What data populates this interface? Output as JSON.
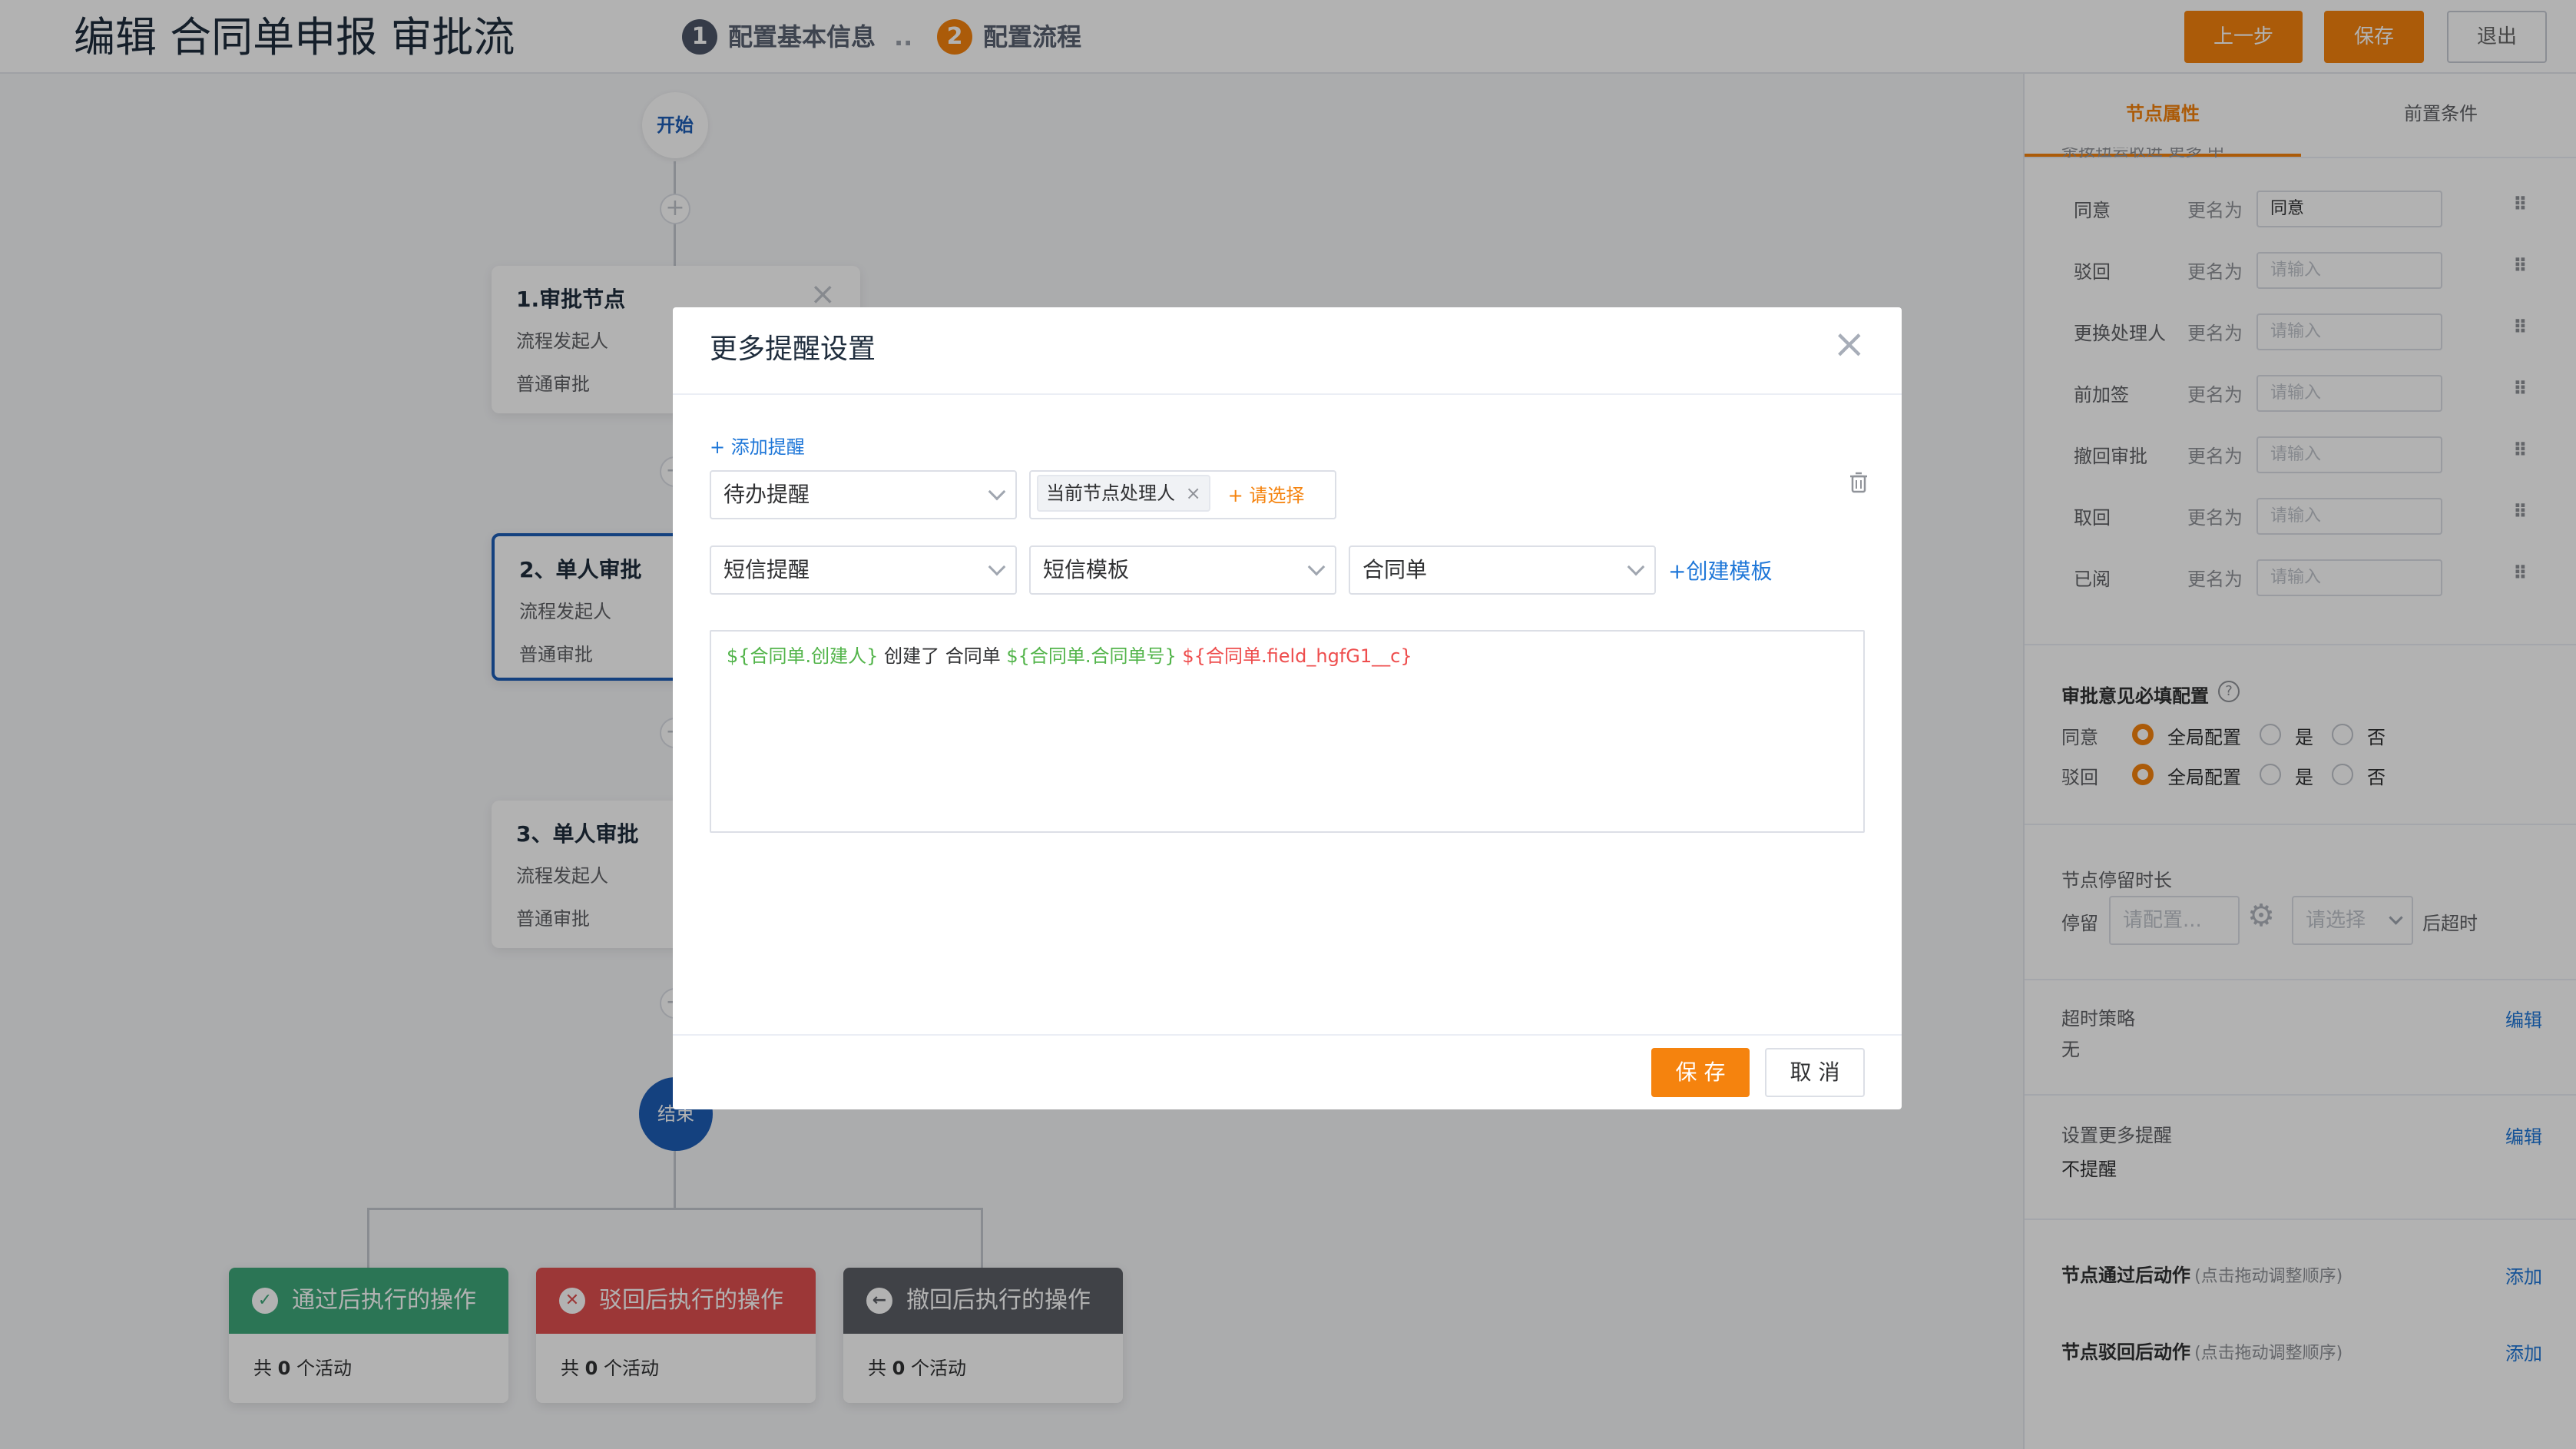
{
  "header": {
    "title": "编辑 合同单申报 审批流",
    "steps": [
      {
        "num": "1",
        "label": "配置基本信息"
      },
      {
        "num": "2",
        "label": "配置流程"
      }
    ],
    "step_sep": "..",
    "buttons": {
      "prev": "上一步",
      "save": "保存",
      "exit": "退出"
    }
  },
  "flow": {
    "start": "开始",
    "end": "结束",
    "plus": "+",
    "nodes": [
      {
        "title": "1.审批节点",
        "line1": "流程发起人",
        "line2": "普通审批"
      },
      {
        "title": "2、单人审批",
        "line1": "流程发起人",
        "line2": "普通审批"
      },
      {
        "title": "3、单人审批",
        "line1": "流程发起人",
        "line2": "普通审批"
      }
    ],
    "node_close": "×",
    "outcomes": [
      {
        "title": "通过后执行的操作",
        "icon": "check-circle-icon",
        "glyph": "✓",
        "color": "#3ea87a",
        "prefix": "共",
        "count": "0",
        "suffix": "个活动"
      },
      {
        "title": "驳回后执行的操作",
        "icon": "x-circle-icon",
        "glyph": "✕",
        "color": "#e04f4f",
        "prefix": "共",
        "count": "0",
        "suffix": "个活动"
      },
      {
        "title": "撤回后执行的操作",
        "icon": "arrow-left-circle-icon",
        "glyph": "←",
        "color": "#5c5f66",
        "prefix": "共",
        "count": "0",
        "suffix": "个活动"
      }
    ]
  },
  "panel": {
    "tabs": [
      "节点属性",
      "前置条件"
    ],
    "cut_text": "条按钮会收进 更多 中",
    "rename_label": "更名为",
    "drag_glyph": "⠿",
    "rename_rows": [
      {
        "label": "同意",
        "value": "同意",
        "placeholder": ""
      },
      {
        "label": "驳回",
        "value": "",
        "placeholder": "请输入"
      },
      {
        "label": "更换处理人",
        "value": "",
        "placeholder": "请输入"
      },
      {
        "label": "前加签",
        "value": "",
        "placeholder": "请输入"
      },
      {
        "label": "撤回审批",
        "value": "",
        "placeholder": "请输入"
      },
      {
        "label": "取回",
        "value": "",
        "placeholder": "请输入"
      },
      {
        "label": "已阅",
        "value": "",
        "placeholder": "请输入"
      }
    ],
    "opinion": {
      "title": "审批意见必填配置",
      "help": "?",
      "rows": [
        {
          "label": "同意",
          "options": [
            "全局配置",
            "是",
            "否"
          ],
          "selected": 0
        },
        {
          "label": "驳回",
          "options": [
            "全局配置",
            "是",
            "否"
          ],
          "selected": 0
        }
      ]
    },
    "stay": {
      "title": "节点停留时长",
      "prefix": "停留",
      "config_placeholder": "请配置...",
      "select_placeholder": "请选择",
      "suffix": "后超时"
    },
    "timeout": {
      "title": "超时策略",
      "value": "无",
      "action": "编辑"
    },
    "remind": {
      "title": "设置更多提醒",
      "value": "不提醒",
      "action": "编辑"
    },
    "pass_action": {
      "title": "节点通过后动作",
      "hint": "(点击拖动调整顺序)",
      "action": "添加"
    },
    "reject_action": {
      "title": "节点驳回后动作",
      "hint": "(点击拖动调整顺序)",
      "action": "添加"
    }
  },
  "modal": {
    "title": "更多提醒设置",
    "close": "×",
    "add": "+ 添加提醒",
    "reminder_type": "待办提醒",
    "recipient_tag": "当前节点处理人",
    "tag_close": "×",
    "recipient_add": "+ 请选择",
    "channel": "短信提醒",
    "template_kind": "短信模板",
    "template_obj": "合同单",
    "create_template": "+创建模板",
    "delete_icon": "trash-icon",
    "message": [
      {
        "text": "${合同单.创建人}",
        "type": "var"
      },
      {
        "text": " 创建了 合同单 ",
        "type": "plain"
      },
      {
        "text": "${合同单.合同单号}",
        "type": "var"
      },
      {
        "text": " ",
        "type": "plain"
      },
      {
        "text": "${合同单.field_hgfG1__c}",
        "type": "err"
      }
    ],
    "save": "保 存",
    "cancel": "取 消"
  },
  "colors": {
    "accent": "#f5830e",
    "link": "#1f77d8",
    "var": "#52b44a",
    "err": "#ee4d4d",
    "node_blue": "#1e5db6",
    "step_gray": "#5a6272"
  }
}
